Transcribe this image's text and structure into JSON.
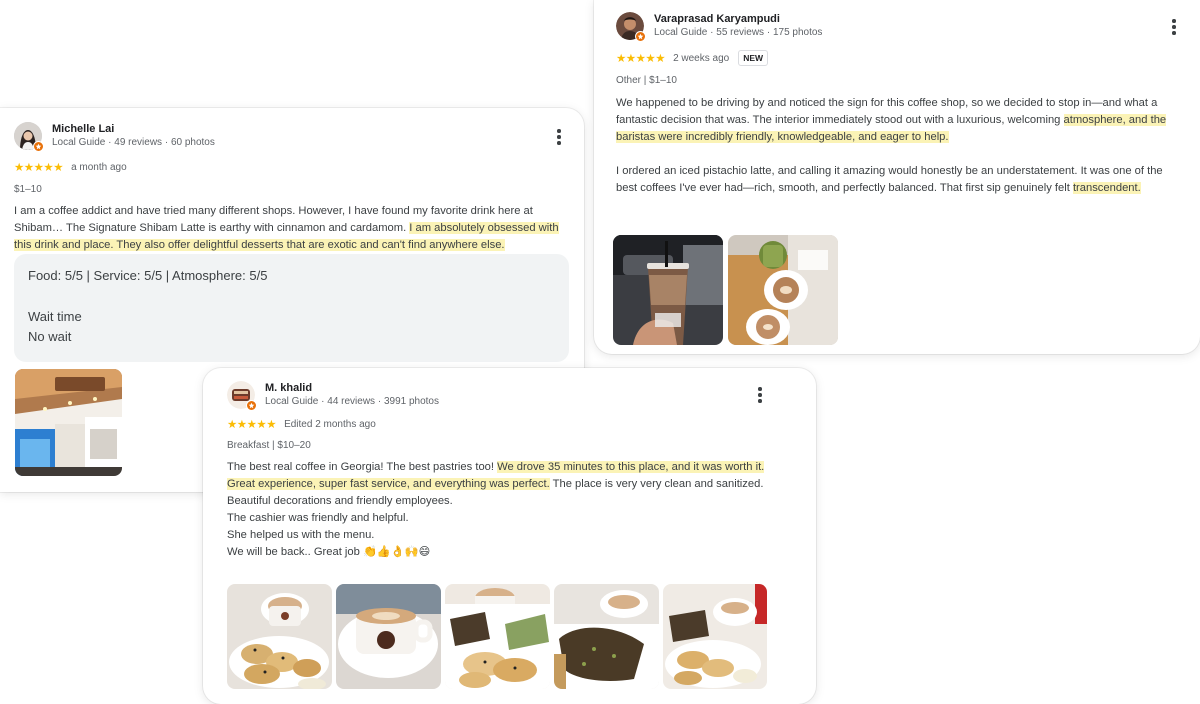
{
  "reviews": [
    {
      "name": "Michelle Lai",
      "meta": "Local Guide · 49 reviews · 60 photos",
      "stars": "★★★★★",
      "date": "a month ago",
      "tags": "$1–10",
      "text_plain": "I am a coffee addict and have tried many different shops. However, I have found my favorite drink here at Shibam… The Signature Shibam Latte is earthy with cinnamon and cardamom. ",
      "text_highlight": "I am absolutely obsessed with this drink and place. They also offer delightful desserts that are exotic and can't find anywhere else.",
      "summary": "Food: 5/5  |  Service: 5/5  |  Atmosphere: 5/5",
      "wait_label": "Wait time",
      "wait_value": "No wait",
      "photo_count": 1
    },
    {
      "name": "Varaprasad Karyampudi",
      "meta": "Local Guide · 55 reviews · 175 photos",
      "stars": "★★★★★",
      "date": "2 weeks ago",
      "badge": "NEW",
      "tags": "Other  |  $1–10",
      "p1_plain": "We happened to be driving by and noticed the sign for this coffee shop, so we decided to stop in—and what a fantastic decision that was. The interior immediately stood out with a luxurious, welcoming ",
      "p1_highlight": "atmosphere, and the baristas were incredibly friendly, knowledgeable, and eager to help.",
      "p2_plain": "I ordered an iced pistachio latte, and calling it amazing would honestly be an understatement. It was one of the best coffees I've ever had—rich, smooth, and perfectly balanced. That first sip genuinely felt ",
      "p2_highlight": "transcendent.",
      "photo_count": 2
    },
    {
      "name": "M. khalid",
      "meta": "Local Guide · 44 reviews · 3991 photos",
      "stars": "★★★★★",
      "date": "Edited 2 months ago",
      "tags": "Breakfast  |  $10–20",
      "l1_plain": "The best real coffee in Georgia! The best pastries too! ",
      "l1_highlight": "We drove 35 minutes to this place, and it was worth it.",
      "l2_highlight": "Great experience, super fast service, and everything was perfect.",
      "l2_plain": " The place is very very clean and sanitized. Beautiful decorations and friendly employees.",
      "l3": "The cashier was friendly and helpful.",
      "l4": "She helped us with the menu.",
      "l5": "We will be back.. Great job 👏👍👌🙌😄",
      "photo_count": 5
    }
  ],
  "colors": {
    "star": "#fbbc04",
    "highlight": "#fbf3b6",
    "local_guide_badge": "#e8710a",
    "summary_bg": "#f1f3f4"
  },
  "icons": [
    "more-vert-icon",
    "local-guide-badge-icon",
    "star-icon"
  ]
}
